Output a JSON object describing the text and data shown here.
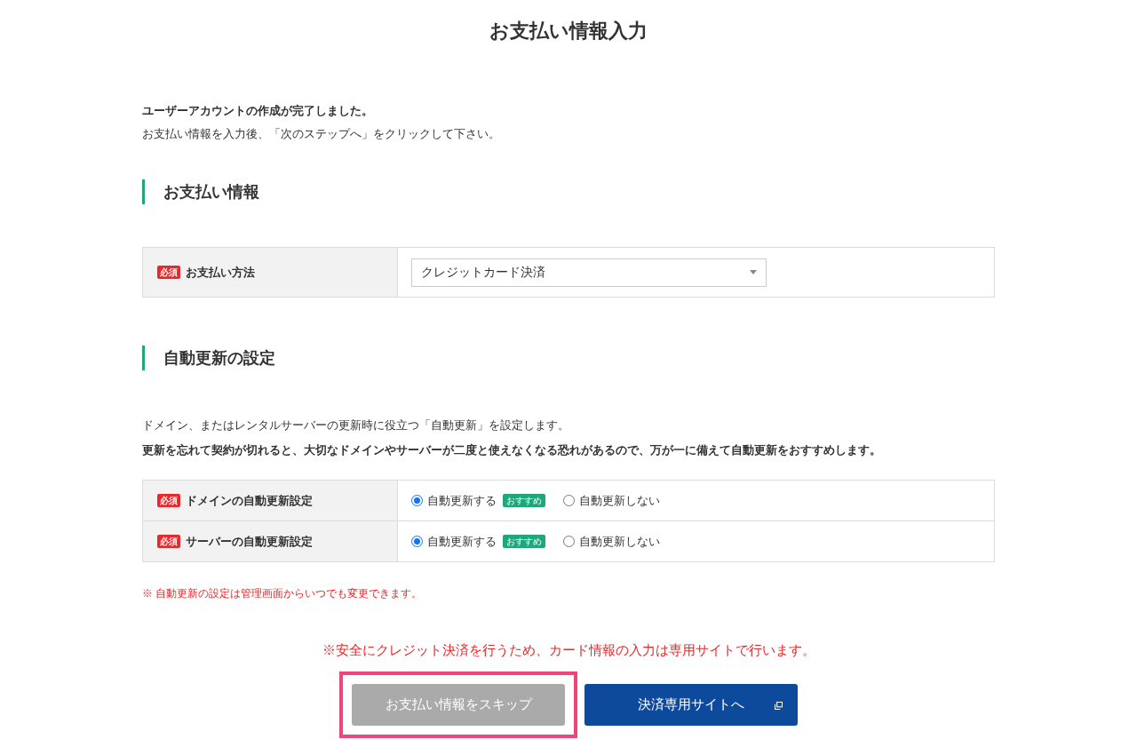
{
  "page_title": "お支払い情報入力",
  "intro": {
    "lead": "ユーザーアカウントの作成が完了しました。",
    "text": "お支払い情報を入力後、「次のステップへ」をクリックして下さい。"
  },
  "payment_section": {
    "heading": "お支払い情報",
    "rows": [
      {
        "required_badge": "必須",
        "label": "お支払い方法",
        "select_value": "クレジットカード決済"
      }
    ]
  },
  "auto_renew_section": {
    "heading": "自動更新の設定",
    "description": "ドメイン、またはレンタルサーバーの更新時に役立つ「自動更新」を設定します。",
    "warning": "更新を忘れて契約が切れると、大切なドメインやサーバーが二度と使えなくなる恐れがあるので、万が一に備えて自動更新をおすすめします。",
    "rows": [
      {
        "required_badge": "必須",
        "label": "ドメインの自動更新設定",
        "options": [
          {
            "label": "自動更新する",
            "badge": "おすすめ",
            "selected": true
          },
          {
            "label": "自動更新しない",
            "selected": false
          }
        ]
      },
      {
        "required_badge": "必須",
        "label": "サーバーの自動更新設定",
        "options": [
          {
            "label": "自動更新する",
            "badge": "おすすめ",
            "selected": true
          },
          {
            "label": "自動更新しない",
            "selected": false
          }
        ]
      }
    ],
    "note": "※ 自動更新の設定は管理画面からいつでも変更できます。"
  },
  "security_notice": "※安全にクレジット決済を行うため、カード情報の入力は専用サイトで行います。",
  "buttons": [
    {
      "kind": "skip",
      "label": "お支払い情報をスキップ",
      "highlighted": true
    },
    {
      "kind": "primary",
      "label": "決済専用サイトへ",
      "external": true
    }
  ]
}
